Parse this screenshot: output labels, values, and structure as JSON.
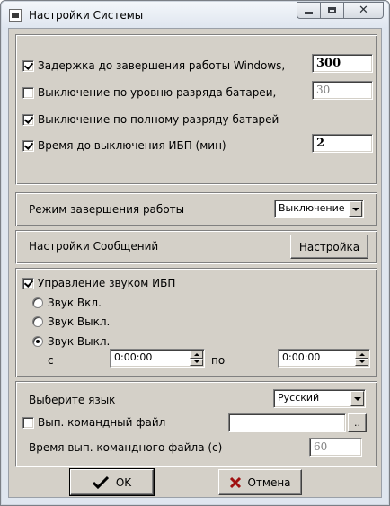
{
  "window": {
    "title": "Настройки Системы",
    "icons": {
      "app": "app-icon",
      "minimize": "minimize-icon",
      "maximize": "maximize-icon",
      "close": "close-icon"
    }
  },
  "shutdown_panel": {
    "delay": {
      "label": "Задержка до завершения работы Windows,",
      "checked": true,
      "value": "300"
    },
    "battery_level": {
      "label": "Выключение по уровню разряда батареи,",
      "checked": false,
      "value": "30"
    },
    "battery_full": {
      "label": "Выключение по полному разряду батарей",
      "checked": true
    },
    "ups_off_time": {
      "label": "Время до выключения ИБП (мин)",
      "checked": true,
      "value": "2"
    }
  },
  "mode_panel": {
    "label": "Режим завершения работы",
    "select_value": "Выключение"
  },
  "messages_panel": {
    "label": "Настройки Сообщений",
    "button": "Настройка"
  },
  "sound_panel": {
    "ups_sound": {
      "label": "Управление звуком ИБП",
      "checked": true
    },
    "radios": [
      {
        "label": "Звук Вкл.",
        "selected": false
      },
      {
        "label": "Звук Выкл.",
        "selected": false
      },
      {
        "label": "Звук Выкл.",
        "selected": true
      }
    ],
    "from_label": "с",
    "from_time": "0:00:00",
    "to_label": "по",
    "to_time": "0:00:00"
  },
  "language_panel": {
    "label": "Выберите язык",
    "select_value": "Русский",
    "cmd_file": {
      "label": "Вып. командный файл",
      "checked": false,
      "value": "",
      "browse": ".."
    },
    "cmd_time": {
      "label": "Время вып. командного файла (с)",
      "value": "60"
    }
  },
  "footer": {
    "ok": "OK",
    "cancel": "Отмена",
    "ok_icon": "checkmark-icon",
    "cancel_icon": "cross-icon"
  }
}
